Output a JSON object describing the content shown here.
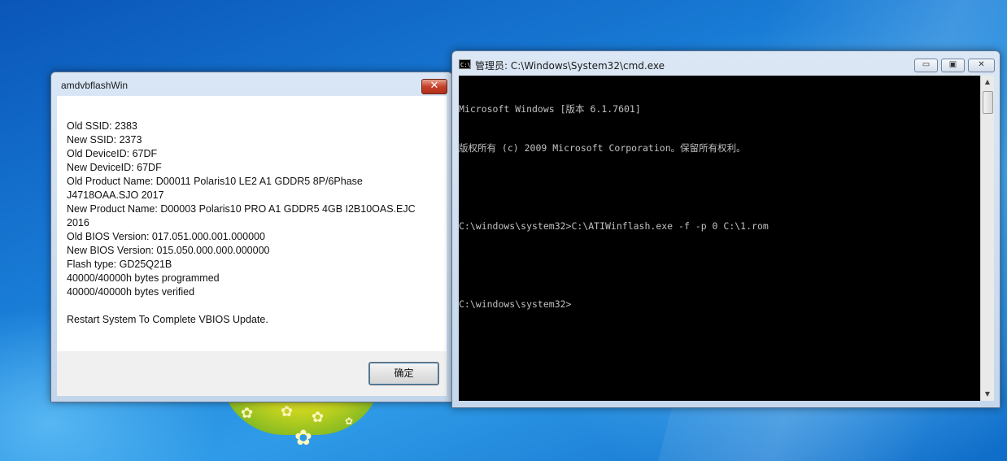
{
  "dialog": {
    "title": "amdvbflashWin",
    "close_glyph": "✕",
    "lines": [
      "Old SSID: 2383",
      "New SSID: 2373",
      "Old DeviceID: 67DF",
      "New DeviceID: 67DF",
      "Old Product Name: D00011 Polaris10 LE2 A1 GDDR5 8P/6Phase",
      "J4718OAA.SJO 2017",
      "New Product Name: D00003 Polaris10 PRO A1 GDDR5 4GB I2B10OAS.EJC",
      "2016",
      "Old BIOS Version: 017.051.000.001.000000",
      "New BIOS Version: 015.050.000.000.000000",
      "Flash type: GD25Q21B",
      "40000/40000h bytes programmed",
      "40000/40000h bytes verified"
    ],
    "footer_message": "Restart System To Complete VBIOS Update.",
    "ok_label": "确定"
  },
  "cmd": {
    "icon_label": "C:\\",
    "title": "管理员: C:\\Windows\\System32\\cmd.exe",
    "minimize_glyph": "▭",
    "maximize_glyph": "▣",
    "close_glyph": "✕",
    "lines": [
      "Microsoft Windows [版本 6.1.7601]",
      "版权所有 (c) 2009 Microsoft Corporation。保留所有权利。",
      "",
      "C:\\windows\\system32>C:\\ATIWinflash.exe -f -p 0 C:\\1.rom",
      "",
      "C:\\windows\\system32>"
    ],
    "scroll_up_glyph": "▲",
    "scroll_down_glyph": "▼"
  },
  "desktop": {
    "wallpaper_colors": [
      "#0a56b8",
      "#2f9be8",
      "#f6e24a"
    ]
  }
}
